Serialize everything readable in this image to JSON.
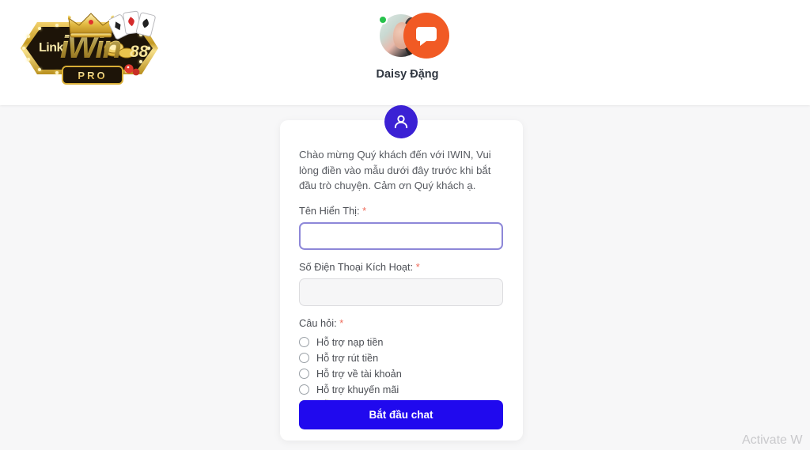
{
  "header": {
    "logo": {
      "link_text": "Link",
      "brand_text": "iWin",
      "number_text": "88",
      "badge_text": "PRO",
      "crown_icon": "crown-icon",
      "cards_icon": "playing-cards-icon",
      "chips_icon": "casino-chips-icon",
      "dice_icon": "dice-icon"
    },
    "agent": {
      "name": "Daisy Đặng",
      "photo_icon": "agent-photo-avatar",
      "online_status_icon": "online-status-dot",
      "chat_bubble_icon": "chat-bubble-icon"
    }
  },
  "card": {
    "avatar_icon": "user-avatar-icon",
    "welcome_message": "Chào mừng Quý khách đến với IWIN, Vui lòng điền vào mẫu dưới đây trước khi bắt đầu trò chuyện. Cảm ơn Quý khách ạ.",
    "fields": {
      "display_name": {
        "label": "Tên Hiển Thị:",
        "required_mark": "*",
        "value": "",
        "placeholder": ""
      },
      "phone": {
        "label": "Số Điện Thoại Kích Hoạt:",
        "required_mark": "*",
        "value": "",
        "placeholder": ""
      },
      "question": {
        "label": "Câu hỏi:",
        "required_mark": "*",
        "options": [
          "Hỗ trợ nạp tiền",
          "Hỗ trợ rút tiền",
          "Hỗ trợ về tài khoản",
          "Hỗ trợ khuyến mãi",
          "Hỗ trợ sản phẩm Game"
        ],
        "selected": null
      }
    },
    "submit_label": "Bắt đầu chat"
  },
  "watermark": {
    "text": "Activate W"
  },
  "colors": {
    "accent_blue": "#2009ee",
    "avatar_blue": "#3b21d4",
    "focus_purple": "#8d87d8",
    "orange_bubble": "#f15a24",
    "online_green": "#27c24c",
    "required_red": "#ef6b5a",
    "gold": "#d6a52c",
    "page_bg": "#f7f7f8"
  }
}
